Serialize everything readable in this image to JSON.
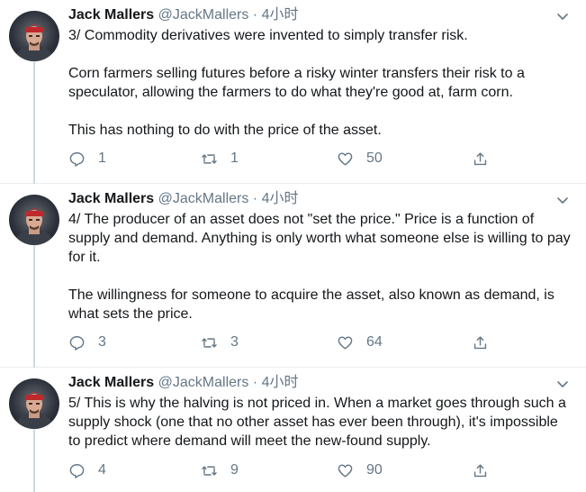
{
  "tweets": [
    {
      "name": "Jack Mallers",
      "handle": "@JackMallers",
      "dot": "·",
      "time": "4小时",
      "paragraphs": [
        "3/ Commodity derivatives were invented to simply transfer risk.",
        "Corn farmers selling futures before a risky winter transfers their risk to a speculator, allowing the farmers to do what they're good at, farm corn.",
        "This has nothing to do with the price of the asset."
      ],
      "replies": "1",
      "retweets": "1",
      "likes": "50"
    },
    {
      "name": "Jack Mallers",
      "handle": "@JackMallers",
      "dot": "·",
      "time": "4小时",
      "paragraphs": [
        "4/ The producer of an asset does not \"set the price.\" Price is a function of supply and demand. Anything is only worth what someone else is willing to pay for it.",
        "The willingness for someone to acquire the asset, also known as demand, is what sets the price."
      ],
      "replies": "3",
      "retweets": "3",
      "likes": "64"
    },
    {
      "name": "Jack Mallers",
      "handle": "@JackMallers",
      "dot": "·",
      "time": "4小时",
      "paragraphs": [
        "5/ This is why the halving is not priced in. When a market goes through such a supply shock (one that no other asset has ever been through), it's impossible to predict where demand will meet the new-found supply."
      ],
      "replies": "4",
      "retweets": "9",
      "likes": "90"
    }
  ],
  "icons": {
    "reply": "reply-icon",
    "retweet": "retweet-icon",
    "like": "heart-icon",
    "share": "share-icon",
    "more": "chevron-down-icon"
  },
  "colors": {
    "text": "#14171a",
    "muted": "#657786",
    "divider": "#e6ecf0",
    "thread": "#cfd9de"
  }
}
